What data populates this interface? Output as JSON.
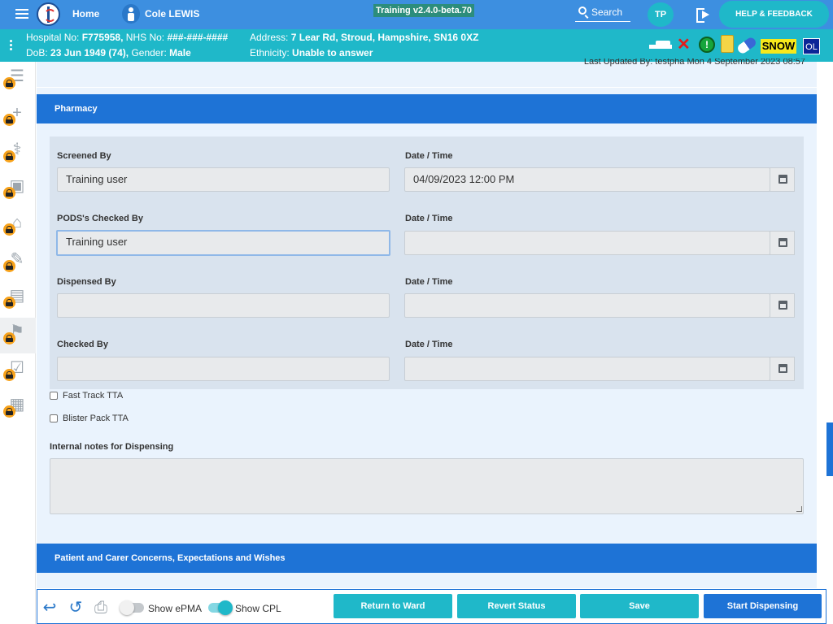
{
  "header": {
    "home_label": "Home",
    "patient_name": "Cole LEWIS",
    "version": "Training v2.4.0-beta.70",
    "search_label": "Search",
    "user_initials": "TP",
    "help_label": "HELP & FEEDBACK"
  },
  "patient": {
    "hospital_label": "Hospital No:",
    "hospital_no": "F775958,",
    "nhs_label": "NHS No:",
    "nhs_no": "###-###-####",
    "address_label": "Address:",
    "address": "7 Lear Rd, Stroud, Hampshire, SN16 0XZ",
    "dob_label": "DoB:",
    "dob": "23 Jun 1949 (74),",
    "gender_label": "Gender:",
    "gender": "Male",
    "ethnicity_label": "Ethnicity:",
    "ethnicity": "Unable to answer",
    "flags": {
      "alert_glyph": "!",
      "snow": "SNOW",
      "ol": "OL"
    }
  },
  "rail": [
    {
      "icon": "list-check-icon",
      "glyph": "☰"
    },
    {
      "icon": "plus-icon",
      "glyph": "+"
    },
    {
      "icon": "stethoscope-icon",
      "glyph": "⚕"
    },
    {
      "icon": "camera-icon",
      "glyph": "▣"
    },
    {
      "icon": "home-plus-icon",
      "glyph": "⌂"
    },
    {
      "icon": "edit-document-icon",
      "glyph": "✎"
    },
    {
      "icon": "clipboard-icon",
      "glyph": "▤"
    },
    {
      "icon": "walking-person-icon",
      "glyph": "⚑"
    },
    {
      "icon": "checklist-icon",
      "glyph": "☑"
    },
    {
      "icon": "building-icon",
      "glyph": "▦"
    }
  ],
  "main": {
    "last_updated": "Last Updated By: testpha Mon 4 September 2023 08:57",
    "pharmacy_title": "Pharmacy",
    "screened_by_label": "Screened By",
    "screened_by_value": "Training user",
    "screened_dt_label": "Date / Time",
    "screened_dt_value": "04/09/2023 12:00 PM",
    "pods_label": "PODS's Checked By",
    "pods_value": "Training user",
    "pods_dt_label": "Date / Time",
    "pods_dt_value": "",
    "dispensed_label": "Dispensed By",
    "dispensed_value": "",
    "dispensed_dt_label": "Date / Time",
    "dispensed_dt_value": "",
    "checked_label": "Checked By",
    "checked_value": "",
    "checked_dt_label": "Date / Time",
    "checked_dt_value": "",
    "fast_track_label": "Fast Track TTA",
    "blister_pack_label": "Blister Pack TTA",
    "internal_notes_label": "Internal notes for Dispensing",
    "internal_notes_value": "",
    "concerns_title": "Patient and Carer Concerns, Expectations and Wishes"
  },
  "footer": {
    "show_epma_label": "Show ePMA",
    "show_epma_on": false,
    "show_cpl_label": "Show CPL",
    "show_cpl_on": true,
    "return_label": "Return to Ward",
    "revert_label": "Revert Status",
    "save_label": "Save",
    "start_label": "Start Dispensing"
  }
}
